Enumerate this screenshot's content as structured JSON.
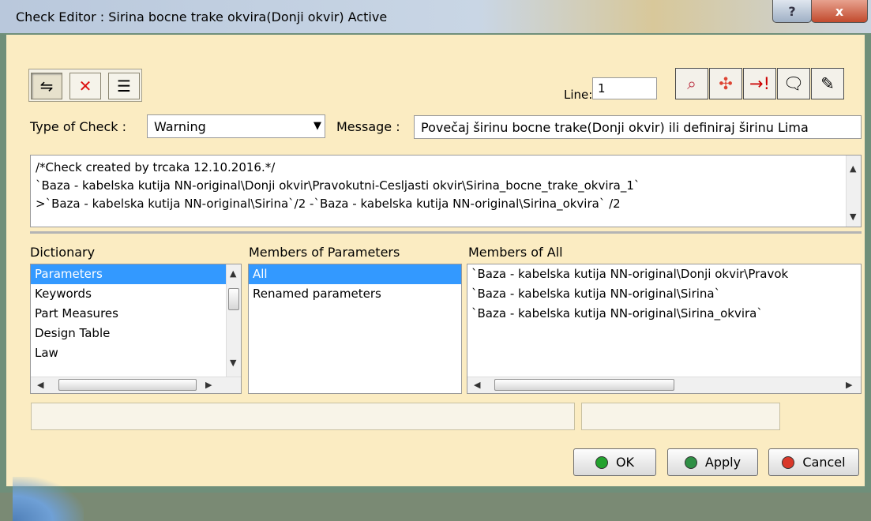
{
  "window": {
    "title": "Check Editor : Sirina bocne trake okvira(Donji okvir) Active",
    "help_button_label": "?",
    "close_button_label": "x"
  },
  "toolbar": {
    "line_label": "Line:",
    "line_value": "1",
    "left_tools": [
      {
        "name": "select-parameters-icon",
        "glyph": "⇋"
      },
      {
        "name": "delete-selection-icon",
        "glyph": "✕"
      },
      {
        "name": "list-text-icon",
        "glyph": "☰"
      }
    ],
    "right_tools": [
      {
        "name": "binoculars-icon",
        "glyph": "⌕"
      },
      {
        "name": "insert-parameter-icon",
        "glyph": "✣"
      },
      {
        "name": "warning-arrow-icon",
        "glyph": "→!"
      },
      {
        "name": "comment-icon",
        "glyph": "🗨"
      },
      {
        "name": "eraser-icon",
        "glyph": "✎"
      }
    ]
  },
  "check": {
    "type_label": "Type of Check :",
    "type_value": "Warning",
    "message_label": "Message :",
    "message_value": "Povečaj širinu bocne trake(Donji okvir) ili definiraj širinu Lima"
  },
  "editor": {
    "lines": [
      "/*Check created by trcaka 12.10.2016.*/",
      "`Baza - kabelska kutija NN-original\\Donji okvir\\Pravokutni-Cesljasti okvir\\Sirina_bocne_trake_okvira_1`",
      ">`Baza - kabelska kutija NN-original\\Sirina`/2 -`Baza - kabelska kutija NN-original\\Sirina_okvira` /2"
    ]
  },
  "dictionary": {
    "header": "Dictionary",
    "items": [
      "Parameters",
      "Keywords",
      "Part Measures",
      "Design Table",
      "Law"
    ],
    "selected_index": 0
  },
  "members_parameters": {
    "header": "Members of Parameters",
    "items": [
      "All",
      "Renamed parameters"
    ],
    "selected_index": 0
  },
  "members_all": {
    "header": "Members of All",
    "items": [
      "`Baza - kabelska kutija NN-original\\Donji okvir\\Pravok",
      "`Baza - kabelska kutija NN-original\\Sirina`",
      "`Baza - kabelska kutija NN-original\\Sirina_okvira`"
    ]
  },
  "buttons": {
    "ok": "OK",
    "apply": "Apply",
    "cancel": "Cancel"
  },
  "colors": {
    "dialog_background": "#fbecc2",
    "selection": "#3399ff",
    "ok_icon": "#23a22e",
    "apply_icon": "#2f8f45",
    "cancel_icon": "#d9382a"
  }
}
